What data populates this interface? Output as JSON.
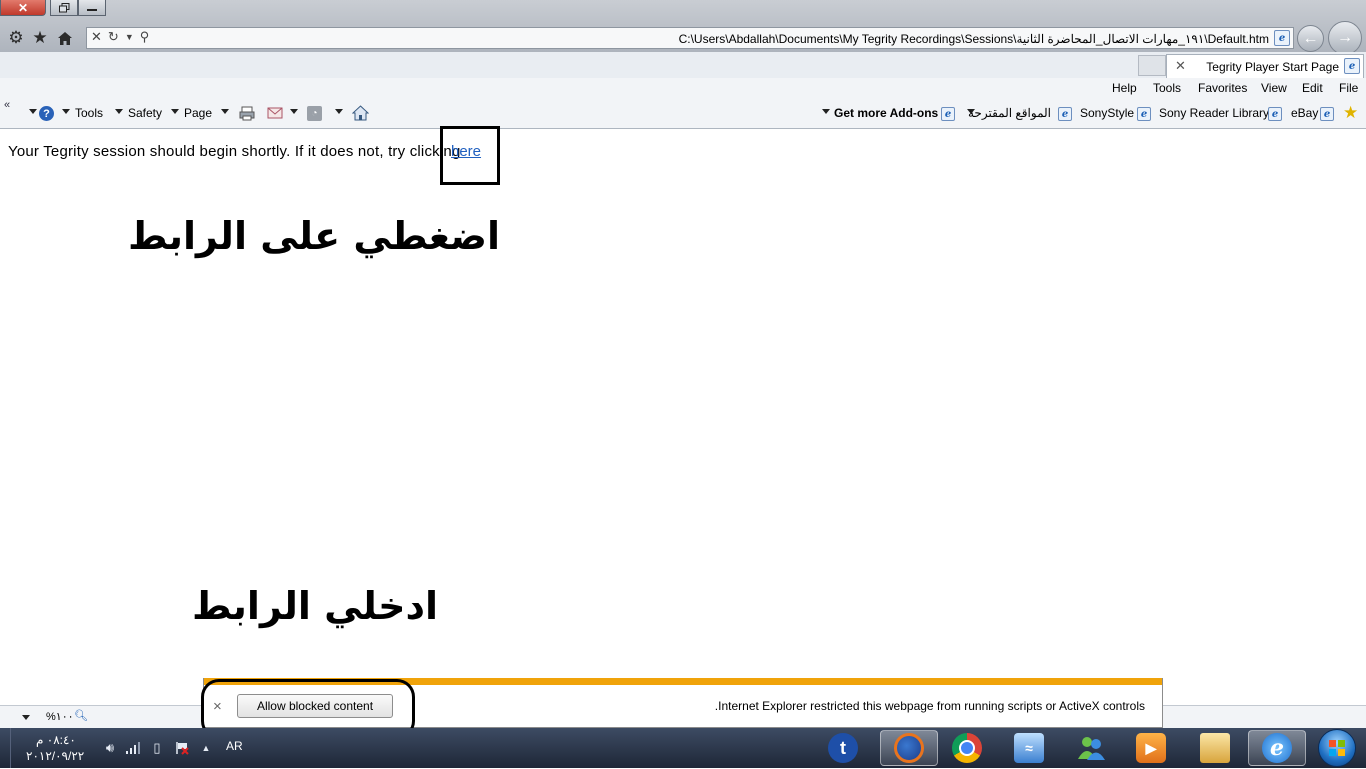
{
  "window": {
    "close_symbol": "✕",
    "address_url": "C:\\Users\\Abdallah\\Documents\\My Tegrity Recordings\\Sessions\\١٩١_مهارات الاتصال_المحاضرة الثانية\\Default.htm"
  },
  "tab": {
    "title": "Tegrity Player Start Page",
    "close_symbol": "✕"
  },
  "menu": {
    "items": [
      "File",
      "Edit",
      "View",
      "Favorites",
      "Tools",
      "Help"
    ]
  },
  "command_bar": {
    "chevrons": "«",
    "page_label": "Page",
    "safety_label": "Safety",
    "tools_label": "Tools"
  },
  "favorites_bar": {
    "items": [
      "eBay",
      "Sony Reader Library",
      "SonyStyle",
      "المواقع المقترحة",
      "Get more Add-ons"
    ]
  },
  "page": {
    "session_text": "Your Tegrity session should begin shortly. If it does not, try clicking",
    "link_text": "here",
    "instruction_1": "اضغطي على الرابط",
    "instruction_2": "ادخلي الرابط"
  },
  "notification": {
    "message": "Internet Explorer restricted this webpage from running scripts or ActiveX controls.",
    "button_label": "Allow blocked content",
    "close_symbol": "×"
  },
  "status_bar": {
    "zoom": "١٠٠%"
  },
  "taskbar": {
    "time": "٠٨:٤٠ م",
    "date": "٢٠١٢/٠٩/٢٢",
    "language": "AR",
    "apps": [
      "tegrity",
      "firefox",
      "chrome",
      "network",
      "messenger",
      "media-player",
      "explorer",
      "internet-explorer"
    ]
  },
  "colors": {
    "notification_stripe": "#f0a30a",
    "link": "#1f5fbf",
    "taskbar": "#1e2737"
  }
}
